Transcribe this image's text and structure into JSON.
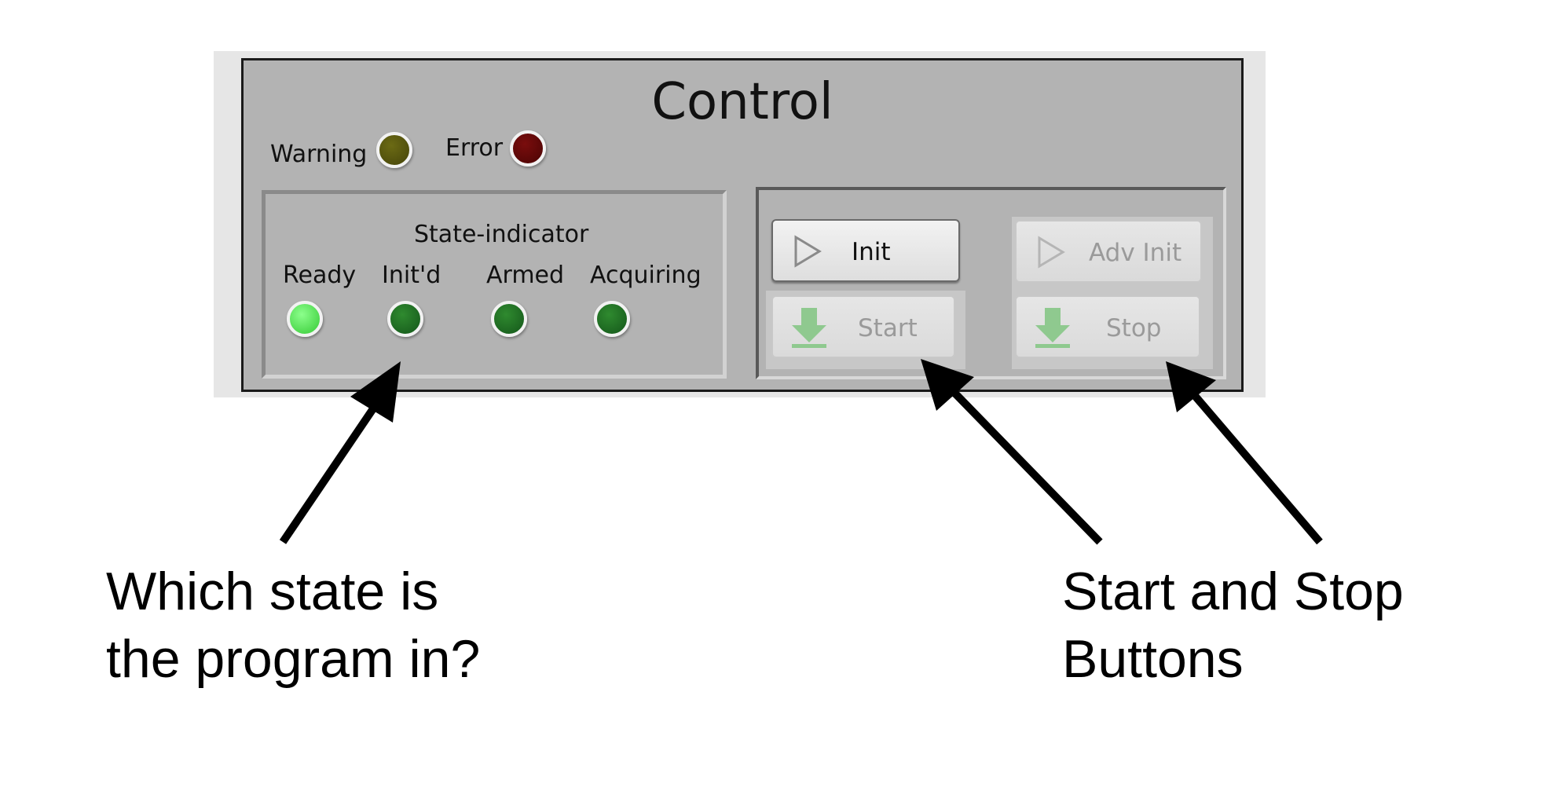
{
  "panel": {
    "title": "Control",
    "warning_label": "Warning",
    "error_label": "Error",
    "state_indicator": {
      "title": "State-indicator",
      "states": [
        {
          "label": "Ready",
          "on": true
        },
        {
          "label": "Init'd",
          "on": false
        },
        {
          "label": "Armed",
          "on": false
        },
        {
          "label": "Acquiring",
          "on": false
        }
      ]
    },
    "buttons": {
      "init": "Init",
      "adv_init": "Adv Init",
      "start": "Start",
      "stop": "Stop"
    }
  },
  "annotations": {
    "left_line1": "Which state is",
    "left_line2": "the program in?",
    "right_line1": "Start and Stop",
    "right_line2": "Buttons"
  },
  "colors": {
    "panel_bg": "#b3b3b3",
    "led_on": "#5bea5b",
    "led_off": "#1f6e22",
    "warning_led": "#55540e",
    "error_led": "#5e0707"
  }
}
